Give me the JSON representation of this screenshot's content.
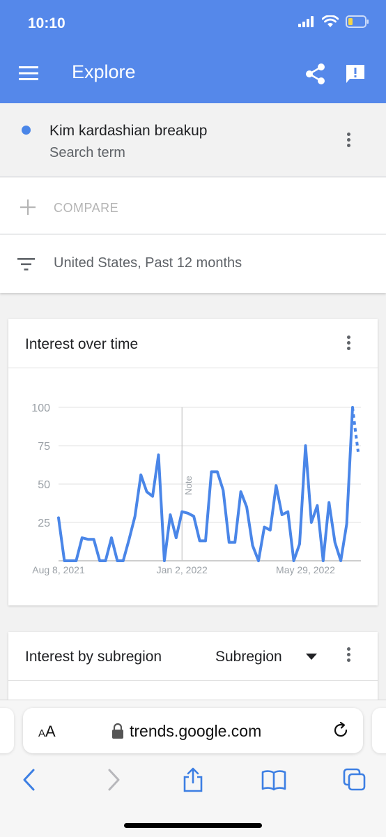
{
  "status": {
    "time": "10:10"
  },
  "toolbar": {
    "title": "Explore"
  },
  "term": {
    "name": "Kim kardashian breakup",
    "type": "Search term",
    "color": "#4a86e8"
  },
  "compare": {
    "label": "COMPARE"
  },
  "filter": {
    "label": "United States, Past 12 months"
  },
  "interest_over_time": {
    "title": "Interest over time",
    "note_label": "Note"
  },
  "chart_data": {
    "type": "line",
    "title": "Interest over time",
    "xlabel": "",
    "ylabel": "",
    "ylim": [
      0,
      100
    ],
    "yticks": [
      25,
      50,
      75,
      100
    ],
    "xtick_labels": [
      "Aug 8, 2021",
      "Jan 2, 2022",
      "May 29, 2022"
    ],
    "grid": true,
    "note_marker_at": "Jan 2, 2022",
    "series": [
      {
        "color": "#4a86e8",
        "values": [
          28,
          0,
          0,
          0,
          15,
          14,
          14,
          0,
          0,
          15,
          0,
          0,
          14,
          29,
          56,
          45,
          42,
          69,
          0,
          30,
          15,
          32,
          31,
          29,
          13,
          13,
          58,
          58,
          46,
          12,
          12,
          45,
          35,
          10,
          0,
          22,
          20,
          49,
          30,
          32,
          0,
          11,
          75,
          25,
          36,
          0,
          38,
          12,
          0,
          24,
          100
        ],
        "partial_tail": [
          100,
          85,
          71
        ]
      }
    ]
  },
  "interest_by_subregion": {
    "title": "Interest by subregion",
    "dropdown_value": "Subregion"
  },
  "browser": {
    "aa_label": "A",
    "aa_big": "A",
    "url": "trends.google.com"
  }
}
